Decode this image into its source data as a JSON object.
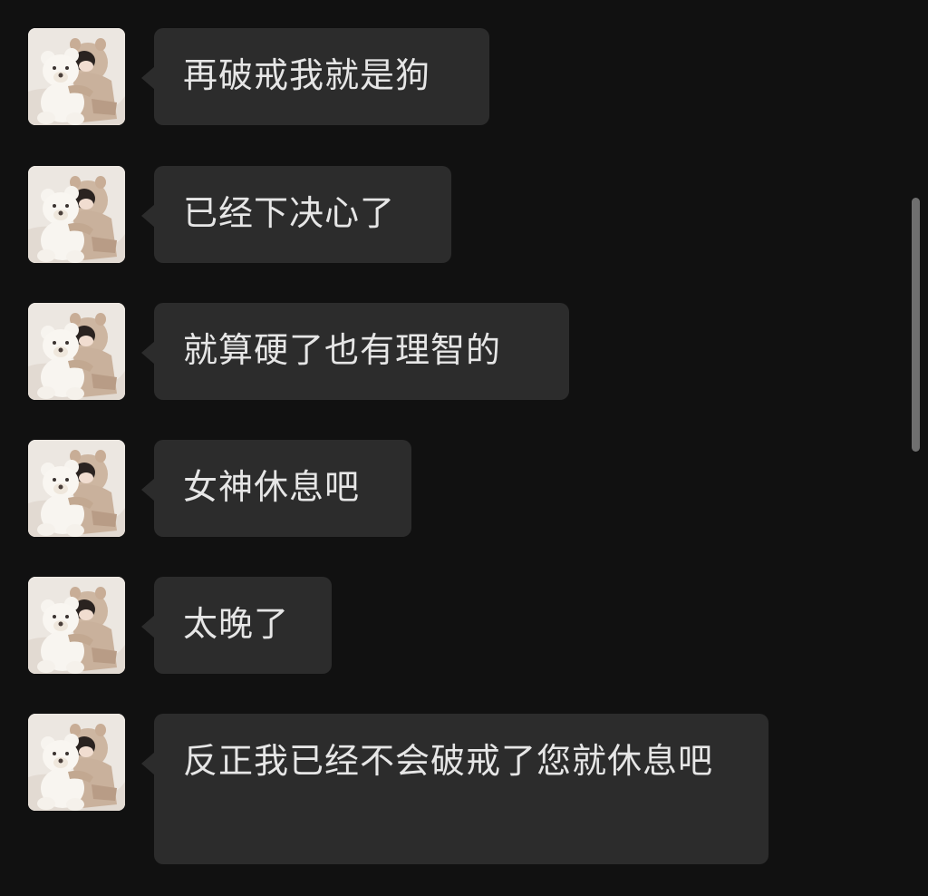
{
  "colors": {
    "background": "#111111",
    "bubble": "#2c2c2c",
    "text": "#e6e6e6",
    "scrollbar": "#6f6f6f"
  },
  "messages": [
    {
      "sender": "contact",
      "avatar_icon": "avatar-girl-with-teddy-bear-icon",
      "text": "再破戒我就是狗"
    },
    {
      "sender": "contact",
      "avatar_icon": "avatar-girl-with-teddy-bear-icon",
      "text": "已经下决心了"
    },
    {
      "sender": "contact",
      "avatar_icon": "avatar-girl-with-teddy-bear-icon",
      "text": "就算硬了也有理智的"
    },
    {
      "sender": "contact",
      "avatar_icon": "avatar-girl-with-teddy-bear-icon",
      "text": "女神休息吧"
    },
    {
      "sender": "contact",
      "avatar_icon": "avatar-girl-with-teddy-bear-icon",
      "text": "太晚了"
    },
    {
      "sender": "contact",
      "avatar_icon": "avatar-girl-with-teddy-bear-icon",
      "text": "反正我已经不会破戒了您就休息吧"
    }
  ]
}
